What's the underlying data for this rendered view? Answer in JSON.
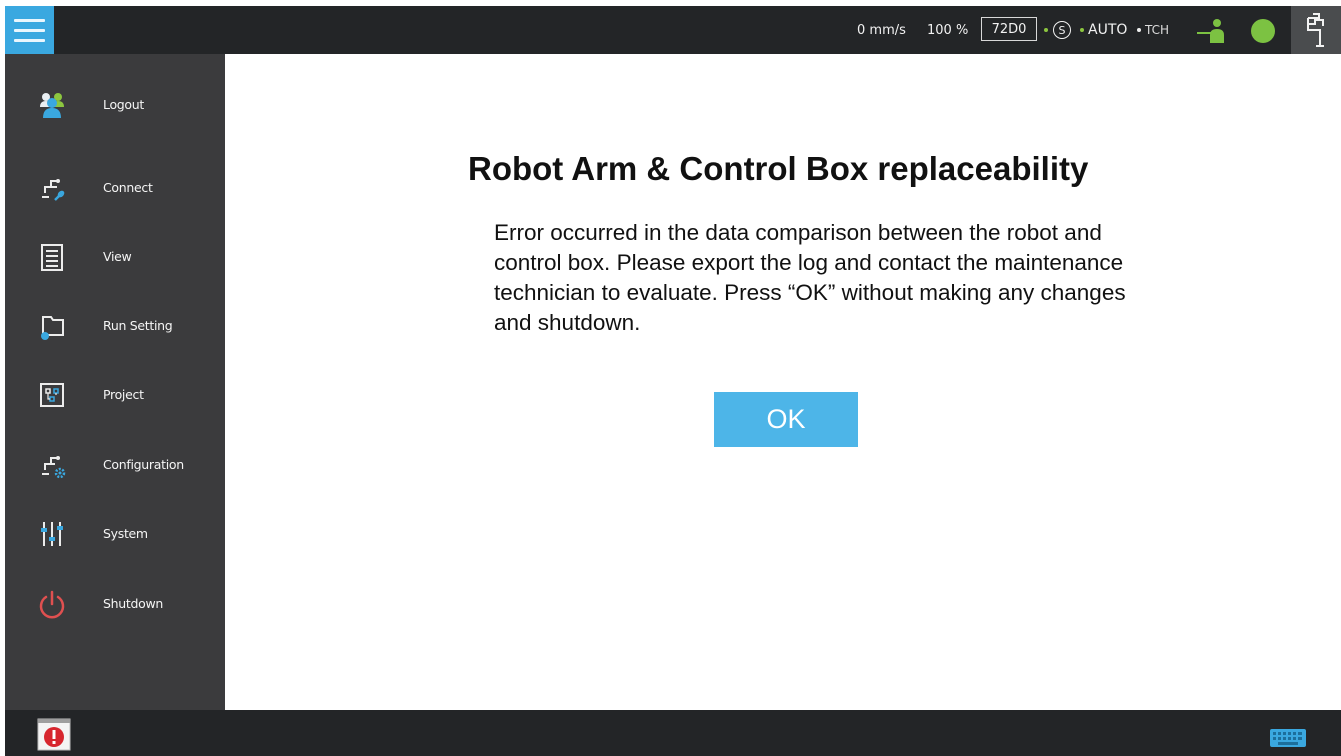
{
  "topbar": {
    "speed": "0 mm/s",
    "percent": "100 %",
    "code": "72D0",
    "safety_letter": "S",
    "mode": "AUTO",
    "tch": "TCH",
    "status_color": "#7cc242",
    "accent_color": "#3aa8e0"
  },
  "sidebar": {
    "items": [
      {
        "label": "Logout",
        "icon": "users-icon"
      },
      {
        "label": "Connect",
        "icon": "connect-icon"
      },
      {
        "label": "View",
        "icon": "view-icon"
      },
      {
        "label": "Run Setting",
        "icon": "run-setting-icon"
      },
      {
        "label": "Project",
        "icon": "project-icon"
      },
      {
        "label": "Configuration",
        "icon": "configuration-icon"
      },
      {
        "label": "System",
        "icon": "sliders-icon"
      },
      {
        "label": "Shutdown",
        "icon": "power-icon"
      }
    ]
  },
  "dialog": {
    "title": "Robot Arm & Control Box replaceability",
    "message": "Error occurred in the data comparison between the robot and control box. Please export the log and contact the maintenance technician to evaluate. Press “OK” without making any changes and shutdown.",
    "ok_label": "OK"
  },
  "bottombar": {
    "alert_icon": "alert-icon",
    "keyboard_icon": "keyboard-icon"
  }
}
